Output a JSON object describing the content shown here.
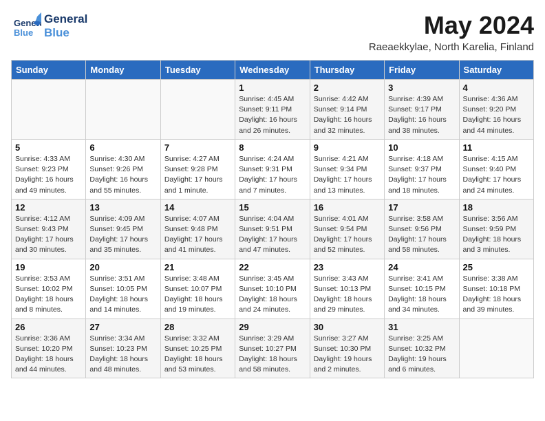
{
  "header": {
    "logo_line1": "General",
    "logo_line2": "Blue",
    "month_title": "May 2024",
    "subtitle": "Raeaekkylae, North Karelia, Finland"
  },
  "days_of_week": [
    "Sunday",
    "Monday",
    "Tuesday",
    "Wednesday",
    "Thursday",
    "Friday",
    "Saturday"
  ],
  "weeks": [
    [
      {
        "num": "",
        "info": ""
      },
      {
        "num": "",
        "info": ""
      },
      {
        "num": "",
        "info": ""
      },
      {
        "num": "1",
        "info": "Sunrise: 4:45 AM\nSunset: 9:11 PM\nDaylight: 16 hours\nand 26 minutes."
      },
      {
        "num": "2",
        "info": "Sunrise: 4:42 AM\nSunset: 9:14 PM\nDaylight: 16 hours\nand 32 minutes."
      },
      {
        "num": "3",
        "info": "Sunrise: 4:39 AM\nSunset: 9:17 PM\nDaylight: 16 hours\nand 38 minutes."
      },
      {
        "num": "4",
        "info": "Sunrise: 4:36 AM\nSunset: 9:20 PM\nDaylight: 16 hours\nand 44 minutes."
      }
    ],
    [
      {
        "num": "5",
        "info": "Sunrise: 4:33 AM\nSunset: 9:23 PM\nDaylight: 16 hours\nand 49 minutes."
      },
      {
        "num": "6",
        "info": "Sunrise: 4:30 AM\nSunset: 9:26 PM\nDaylight: 16 hours\nand 55 minutes."
      },
      {
        "num": "7",
        "info": "Sunrise: 4:27 AM\nSunset: 9:28 PM\nDaylight: 17 hours\nand 1 minute."
      },
      {
        "num": "8",
        "info": "Sunrise: 4:24 AM\nSunset: 9:31 PM\nDaylight: 17 hours\nand 7 minutes."
      },
      {
        "num": "9",
        "info": "Sunrise: 4:21 AM\nSunset: 9:34 PM\nDaylight: 17 hours\nand 13 minutes."
      },
      {
        "num": "10",
        "info": "Sunrise: 4:18 AM\nSunset: 9:37 PM\nDaylight: 17 hours\nand 18 minutes."
      },
      {
        "num": "11",
        "info": "Sunrise: 4:15 AM\nSunset: 9:40 PM\nDaylight: 17 hours\nand 24 minutes."
      }
    ],
    [
      {
        "num": "12",
        "info": "Sunrise: 4:12 AM\nSunset: 9:43 PM\nDaylight: 17 hours\nand 30 minutes."
      },
      {
        "num": "13",
        "info": "Sunrise: 4:09 AM\nSunset: 9:45 PM\nDaylight: 17 hours\nand 35 minutes."
      },
      {
        "num": "14",
        "info": "Sunrise: 4:07 AM\nSunset: 9:48 PM\nDaylight: 17 hours\nand 41 minutes."
      },
      {
        "num": "15",
        "info": "Sunrise: 4:04 AM\nSunset: 9:51 PM\nDaylight: 17 hours\nand 47 minutes."
      },
      {
        "num": "16",
        "info": "Sunrise: 4:01 AM\nSunset: 9:54 PM\nDaylight: 17 hours\nand 52 minutes."
      },
      {
        "num": "17",
        "info": "Sunrise: 3:58 AM\nSunset: 9:56 PM\nDaylight: 17 hours\nand 58 minutes."
      },
      {
        "num": "18",
        "info": "Sunrise: 3:56 AM\nSunset: 9:59 PM\nDaylight: 18 hours\nand 3 minutes."
      }
    ],
    [
      {
        "num": "19",
        "info": "Sunrise: 3:53 AM\nSunset: 10:02 PM\nDaylight: 18 hours\nand 8 minutes."
      },
      {
        "num": "20",
        "info": "Sunrise: 3:51 AM\nSunset: 10:05 PM\nDaylight: 18 hours\nand 14 minutes."
      },
      {
        "num": "21",
        "info": "Sunrise: 3:48 AM\nSunset: 10:07 PM\nDaylight: 18 hours\nand 19 minutes."
      },
      {
        "num": "22",
        "info": "Sunrise: 3:45 AM\nSunset: 10:10 PM\nDaylight: 18 hours\nand 24 minutes."
      },
      {
        "num": "23",
        "info": "Sunrise: 3:43 AM\nSunset: 10:13 PM\nDaylight: 18 hours\nand 29 minutes."
      },
      {
        "num": "24",
        "info": "Sunrise: 3:41 AM\nSunset: 10:15 PM\nDaylight: 18 hours\nand 34 minutes."
      },
      {
        "num": "25",
        "info": "Sunrise: 3:38 AM\nSunset: 10:18 PM\nDaylight: 18 hours\nand 39 minutes."
      }
    ],
    [
      {
        "num": "26",
        "info": "Sunrise: 3:36 AM\nSunset: 10:20 PM\nDaylight: 18 hours\nand 44 minutes."
      },
      {
        "num": "27",
        "info": "Sunrise: 3:34 AM\nSunset: 10:23 PM\nDaylight: 18 hours\nand 48 minutes."
      },
      {
        "num": "28",
        "info": "Sunrise: 3:32 AM\nSunset: 10:25 PM\nDaylight: 18 hours\nand 53 minutes."
      },
      {
        "num": "29",
        "info": "Sunrise: 3:29 AM\nSunset: 10:27 PM\nDaylight: 18 hours\nand 58 minutes."
      },
      {
        "num": "30",
        "info": "Sunrise: 3:27 AM\nSunset: 10:30 PM\nDaylight: 19 hours\nand 2 minutes."
      },
      {
        "num": "31",
        "info": "Sunrise: 3:25 AM\nSunset: 10:32 PM\nDaylight: 19 hours\nand 6 minutes."
      },
      {
        "num": "",
        "info": ""
      }
    ]
  ]
}
